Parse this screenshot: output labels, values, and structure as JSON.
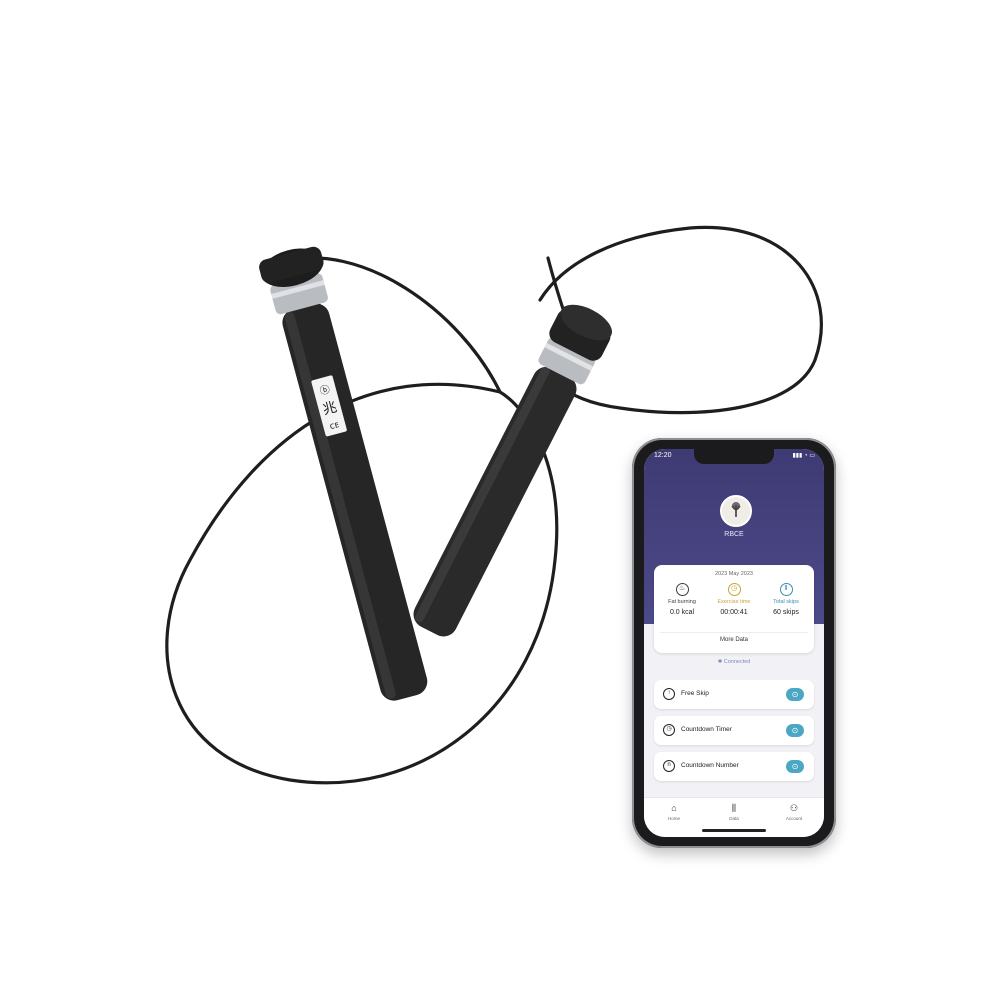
{
  "phone": {
    "status_time": "12:20",
    "status_icons": "▮▮▮ ◔ ▭",
    "username": "RBCE",
    "record_date": "2023 May 2023",
    "stats": [
      {
        "label": "Fat burning",
        "value": "0.0 kcal",
        "color": "#3d3d3d",
        "icon": "flame-icon",
        "glyph": "♨"
      },
      {
        "label": "Exercise time",
        "value": "00:00:41",
        "color": "#c9a43a",
        "icon": "clock-icon",
        "glyph": "◷"
      },
      {
        "label": "Total skips",
        "value": "60 skips",
        "color": "#3a8fb0",
        "icon": "skip-icon",
        "glyph": "Ⅱ"
      }
    ],
    "more_data": "More Data",
    "bluetooth_status": "✱ Connected",
    "modes": [
      {
        "label": "Free Skip",
        "icon": "free-skip-icon",
        "glyph": "↑",
        "go": "⊙"
      },
      {
        "label": "Countdown Timer",
        "icon": "timer-icon",
        "glyph": "◷",
        "go": "⊙"
      },
      {
        "label": "Countdown Number",
        "icon": "number-icon",
        "glyph": "n",
        "go": "⊙"
      }
    ],
    "tabs": [
      {
        "label": "Home",
        "icon": "home-icon",
        "glyph": "⌂"
      },
      {
        "label": "Data",
        "icon": "data-icon",
        "glyph": "⫼"
      },
      {
        "label": "Account",
        "icon": "account-icon",
        "glyph": "⚇"
      }
    ],
    "colors": {
      "header": "#4a4787",
      "accent": "#4ca7c4"
    }
  },
  "handle_label": {
    "line1": "ⓑ",
    "line2": "兆",
    "line3": "ᴄᴇ"
  }
}
